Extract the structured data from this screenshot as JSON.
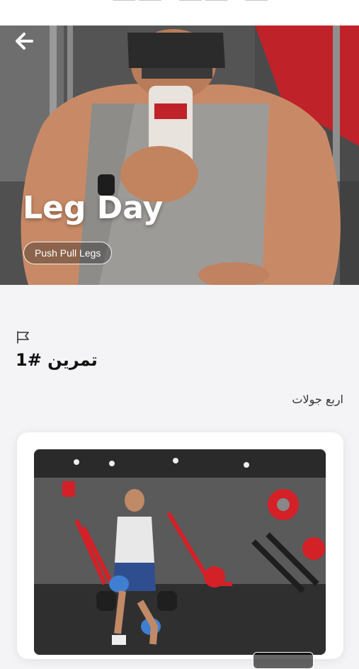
{
  "hero": {
    "title": "Leg Day",
    "tag": "Push Pull Legs"
  },
  "icons": {
    "back": "arrow-left-icon",
    "flag": "flag-icon"
  },
  "exercise": {
    "title": "تمرين #1",
    "rounds": "اربع جولات"
  },
  "colors": {
    "background": "#f4f4f6",
    "card": "#ffffff",
    "gym_red": "#d42027"
  }
}
